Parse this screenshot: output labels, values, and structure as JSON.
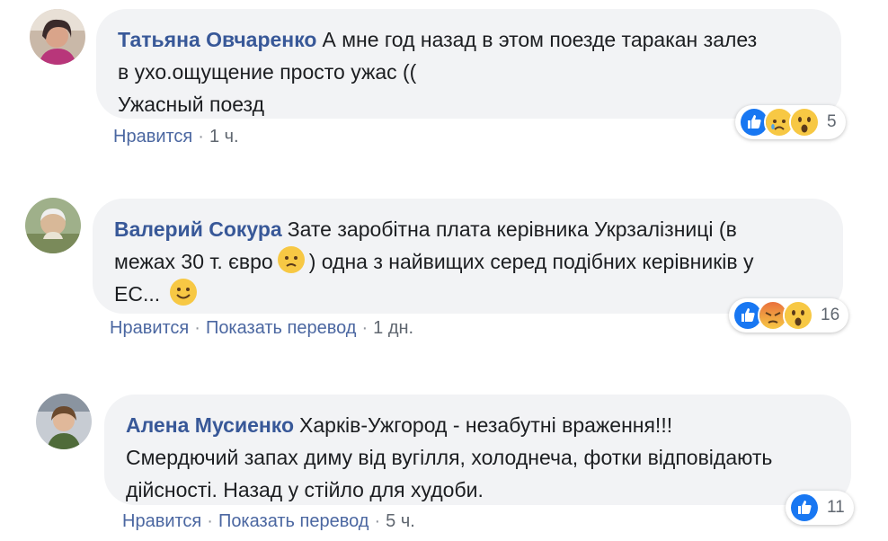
{
  "comments": [
    {
      "author": "Татьяна Овчаренко",
      "text_lines": [
        "А мне год назад в этом поезде таракан залез",
        "в ухо.ощущение просто ужас ((",
        "Ужасный поезд"
      ],
      "actions": {
        "like": "Нравится",
        "time": "1 ч."
      },
      "reactions": {
        "icons": [
          "like-icon",
          "sad-icon",
          "wow-icon"
        ],
        "count": "5"
      }
    },
    {
      "author": "Валерий Сокура",
      "text_line1": "Зате заробітна плата керівника Укрзалізниці (в",
      "text_line2_a": "межах 30 т. євро",
      "text_line2_b": ") одна з найвищих серед подібних керівників у",
      "text_line3": "ЕС...",
      "actions": {
        "like": "Нравится",
        "translate": "Показать перевод",
        "time": "1 дн."
      },
      "reactions": {
        "icons": [
          "like-icon",
          "angry-icon",
          "wow-icon"
        ],
        "count": "16"
      }
    },
    {
      "author": "Алена Мусиенко",
      "text_lines": [
        "Харків-Ужгород - незабутні враження!!!",
        "Смердючий запах диму від вугілля, холоднеча, фотки відповідають",
        "дійсності. Назад у стійло для худоби."
      ],
      "actions": {
        "like": "Нравится",
        "translate": "Показать перевод",
        "time": "5 ч."
      },
      "reactions": {
        "icons": [
          "like-icon"
        ],
        "count": "11"
      }
    }
  ],
  "separator": "·",
  "colors": {
    "author": "#385898",
    "link": "#4b67a1",
    "bubble": "#f2f3f5",
    "like": "#1877f2",
    "emoji": "#f7c844",
    "angry": "#e9713d"
  }
}
